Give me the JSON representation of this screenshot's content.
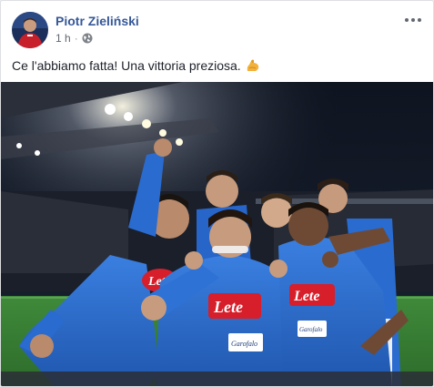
{
  "post": {
    "author": "Piotr Zieliński",
    "timestamp": "1 h",
    "separator": "·",
    "privacy_icon": "globe-icon",
    "options_icon": "more-options-icon",
    "message": "Ce l'abbiamo fatta! Una vittoria preziosa.",
    "message_emoji": "flexed-biceps-icon"
  },
  "photo": {
    "jersey_sponsor": "Lete",
    "secondary_sponsor": "Garofalo"
  },
  "colors": {
    "link": "#365899",
    "napoli_blue": "#2f6fd0",
    "sponsor_red": "#d61f2a"
  }
}
